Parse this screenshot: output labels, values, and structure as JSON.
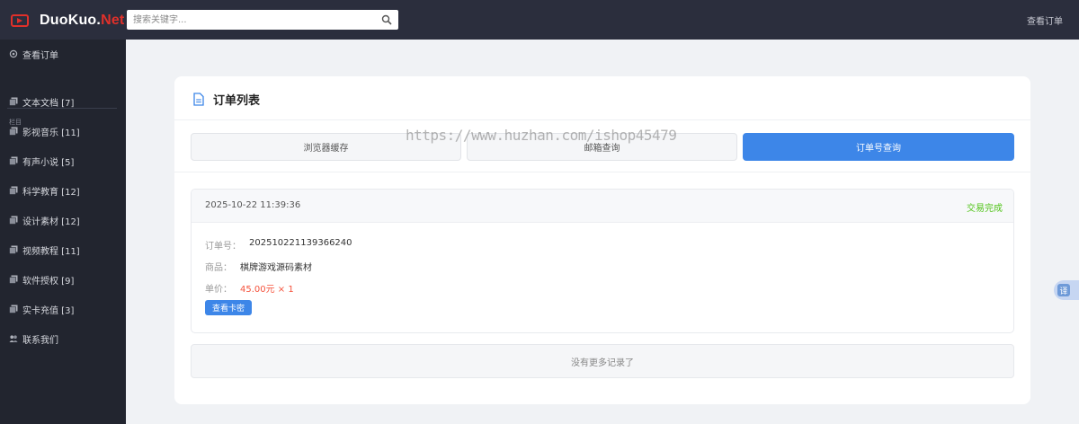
{
  "header": {
    "logo_main": "DuoKuo.",
    "logo_accent": "Net",
    "search_placeholder": "搜索关键字...",
    "right_link": "查看订单"
  },
  "sidebar": {
    "top_item": "查看订单",
    "section_label": "栏目",
    "items": [
      {
        "label": "文本文档 [7]"
      },
      {
        "label": "影视音乐 [11]"
      },
      {
        "label": "有声小说 [5]"
      },
      {
        "label": "科学教育 [12]"
      },
      {
        "label": "设计素材 [12]"
      },
      {
        "label": "视频教程 [11]"
      },
      {
        "label": "软件授权 [9]"
      },
      {
        "label": "实卡充值 [3]"
      }
    ],
    "contact": "联系我们"
  },
  "main": {
    "title": "订单列表",
    "tabs": [
      {
        "label": "浏览器缓存",
        "active": false
      },
      {
        "label": "邮箱查询",
        "active": false
      },
      {
        "label": "订单号查询",
        "active": true
      }
    ],
    "order": {
      "time": "2025-10-22 11:39:36",
      "status": "交易完成",
      "order_no_label": "订单号：",
      "order_no": "202510221139366240",
      "product_label": "商品：",
      "product": "棋牌游戏源码素材",
      "price_label": "单价：",
      "price": "45.00元 × 1",
      "view_card_button": "查看卡密"
    },
    "no_more": "没有更多记录了"
  },
  "watermark": "https://www.huzhan.com/ishop45479",
  "float_button": "译",
  "colors": {
    "topbar": "#2b2e3d",
    "sidebar": "#22252f",
    "accent_blue": "#3d86e8",
    "logo_red": "#e0302a",
    "status_green": "#52c41a",
    "price_red": "#f5533d"
  }
}
